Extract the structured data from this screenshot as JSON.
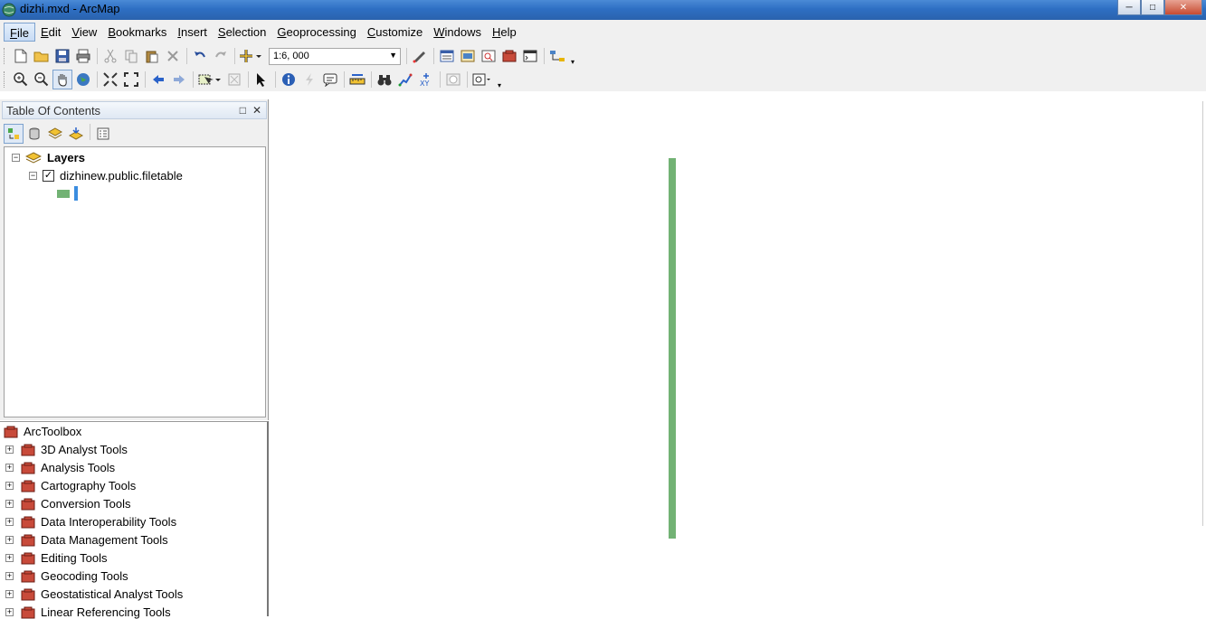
{
  "window": {
    "title": "dizhi.mxd - ArcMap",
    "minimize": "─",
    "maximize": "□",
    "close": "✕"
  },
  "menu": [
    {
      "label": "File",
      "ul": "F",
      "rest": "ile"
    },
    {
      "label": "Edit",
      "ul": "E",
      "rest": "dit"
    },
    {
      "label": "View",
      "ul": "V",
      "rest": "iew"
    },
    {
      "label": "Bookmarks",
      "ul": "B",
      "rest": "ookmarks"
    },
    {
      "label": "Insert",
      "ul": "I",
      "rest": "nsert"
    },
    {
      "label": "Selection",
      "ul": "S",
      "rest": "election"
    },
    {
      "label": "Geoprocessing",
      "ul": "G",
      "rest": "eoprocessing"
    },
    {
      "label": "Customize",
      "ul": "C",
      "rest": "ustomize"
    },
    {
      "label": "Windows",
      "ul": "W",
      "rest": "indows"
    },
    {
      "label": "Help",
      "ul": "H",
      "rest": "elp"
    }
  ],
  "toolbar": {
    "scale": "1:6, 000",
    "scale_dropdown": "▼"
  },
  "toc": {
    "title": "Table Of Contents",
    "float_btn": "□",
    "close_btn": "✕",
    "layers_label": "Layers",
    "layer_name": "dizhinew.public.filetable",
    "expander_minus": "⊟",
    "checked": "✓"
  },
  "toolbox": {
    "title": "ArcToolbox",
    "expander_plus": "+",
    "items": [
      "3D Analyst Tools",
      "Analysis Tools",
      "Cartography Tools",
      "Conversion Tools",
      "Data Interoperability Tools",
      "Data Management Tools",
      "Editing Tools",
      "Geocoding Tools",
      "Geostatistical Analyst Tools",
      "Linear Referencing Tools"
    ]
  },
  "colors": {
    "feature": "#72b274",
    "legend_swatch": "#72b274",
    "legend_highlight": "#3b8de0"
  }
}
